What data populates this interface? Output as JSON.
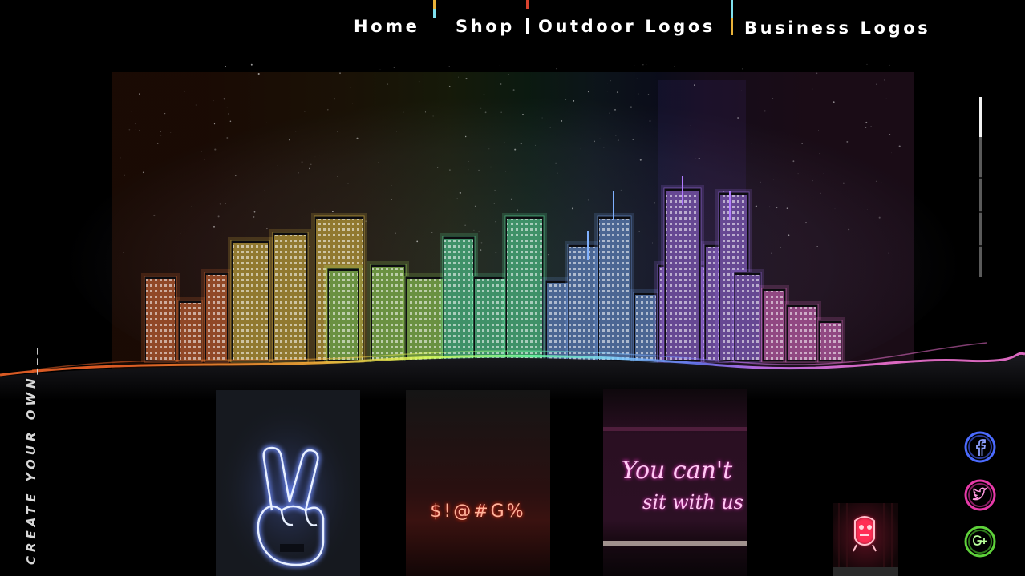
{
  "nav": {
    "items": [
      {
        "label": "Home"
      },
      {
        "label": "Shop"
      },
      {
        "label": "Outdoor Logos"
      },
      {
        "label": "Business Logos"
      }
    ],
    "separator_colors": [
      [
        "#e8b23a",
        "#7fe0ee"
      ],
      [
        "#d9432f",
        "#ffffff"
      ],
      [
        "#7fe0ee",
        "#e8b23a"
      ]
    ]
  },
  "tagline": "CREATE YOUR OWN___",
  "cards": [
    {
      "name": "peace-hand-neon",
      "glow": "#aac4ff"
    },
    {
      "name": "symbols-neon",
      "text": "$!@#G%",
      "glow": "#ff3b2a"
    },
    {
      "name": "quote-neon",
      "line1": "You can't",
      "line2": "sit with us",
      "glow": "#ff4fd2"
    },
    {
      "name": "robot-neon",
      "glow": "#ff2e55"
    }
  ],
  "social": [
    {
      "icon": "facebook-icon",
      "color": "#4b6bff"
    },
    {
      "icon": "twitter-icon",
      "color": "#e63aa8"
    },
    {
      "icon": "google-plus-icon",
      "color": "#5ed13a"
    }
  ],
  "skyline_colors": [
    "#ff7a3a",
    "#ffd34a",
    "#b8ff6a",
    "#6affb0",
    "#7fb0ff",
    "#b07aff",
    "#ff7ae0"
  ]
}
